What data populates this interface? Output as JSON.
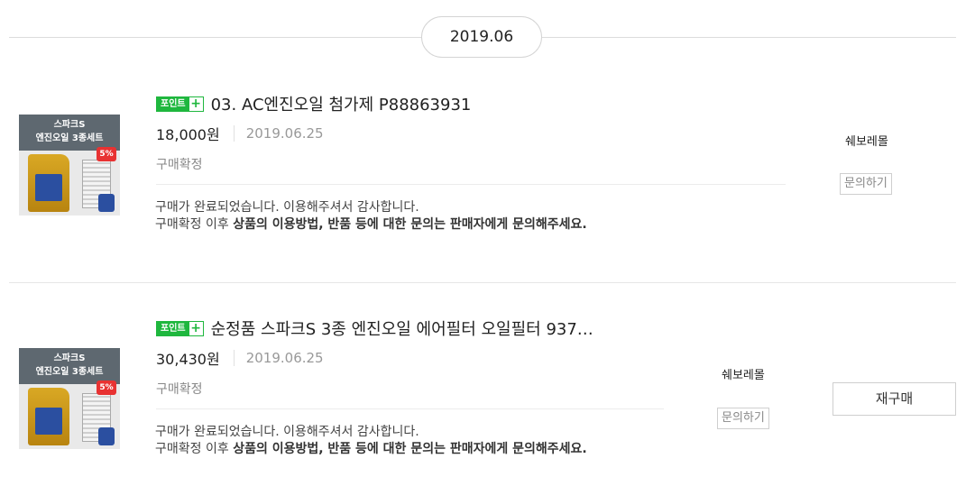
{
  "month": "2019.06",
  "orders": [
    {
      "thumb_line1": "스파크S",
      "thumb_line2": "엔진오일 3종세트",
      "thumb_badge": "5%",
      "point_label": "포인트",
      "point_plus": "+",
      "title": "03. AC엔진오일 첨가제 P88863931",
      "price": "18,000원",
      "date": "2019.06.25",
      "status": "구매확정",
      "message_line1": "구매가 완료되었습니다. 이용해주셔서 감사합니다.",
      "message_line2_prefix": "구매확정 이후 ",
      "message_line2_bold": "상품의 이용방법, 반품 등에 대한 문의는 판매자에게 문의해주세요.",
      "seller": "쉐보레몰",
      "inquiry_label": "문의하기"
    },
    {
      "thumb_line1": "스파크S",
      "thumb_line2": "엔진오일 3종세트",
      "thumb_badge": "5%",
      "point_label": "포인트",
      "point_plus": "+",
      "title": "순정품 스파크S 3종 엔진오일 에어필터 오일필터 937…",
      "price": "30,430원",
      "date": "2019.06.25",
      "status": "구매확정",
      "message_line1": "구매가 완료되었습니다. 이용해주셔서 감사합니다.",
      "message_line2_prefix": "구매확정 이후 ",
      "message_line2_bold": "상품의 이용방법, 반품 등에 대한 문의는 판매자에게 문의해주세요.",
      "seller": "쉐보레몰",
      "inquiry_label": "문의하기",
      "rebuy_label": "재구매"
    }
  ]
}
